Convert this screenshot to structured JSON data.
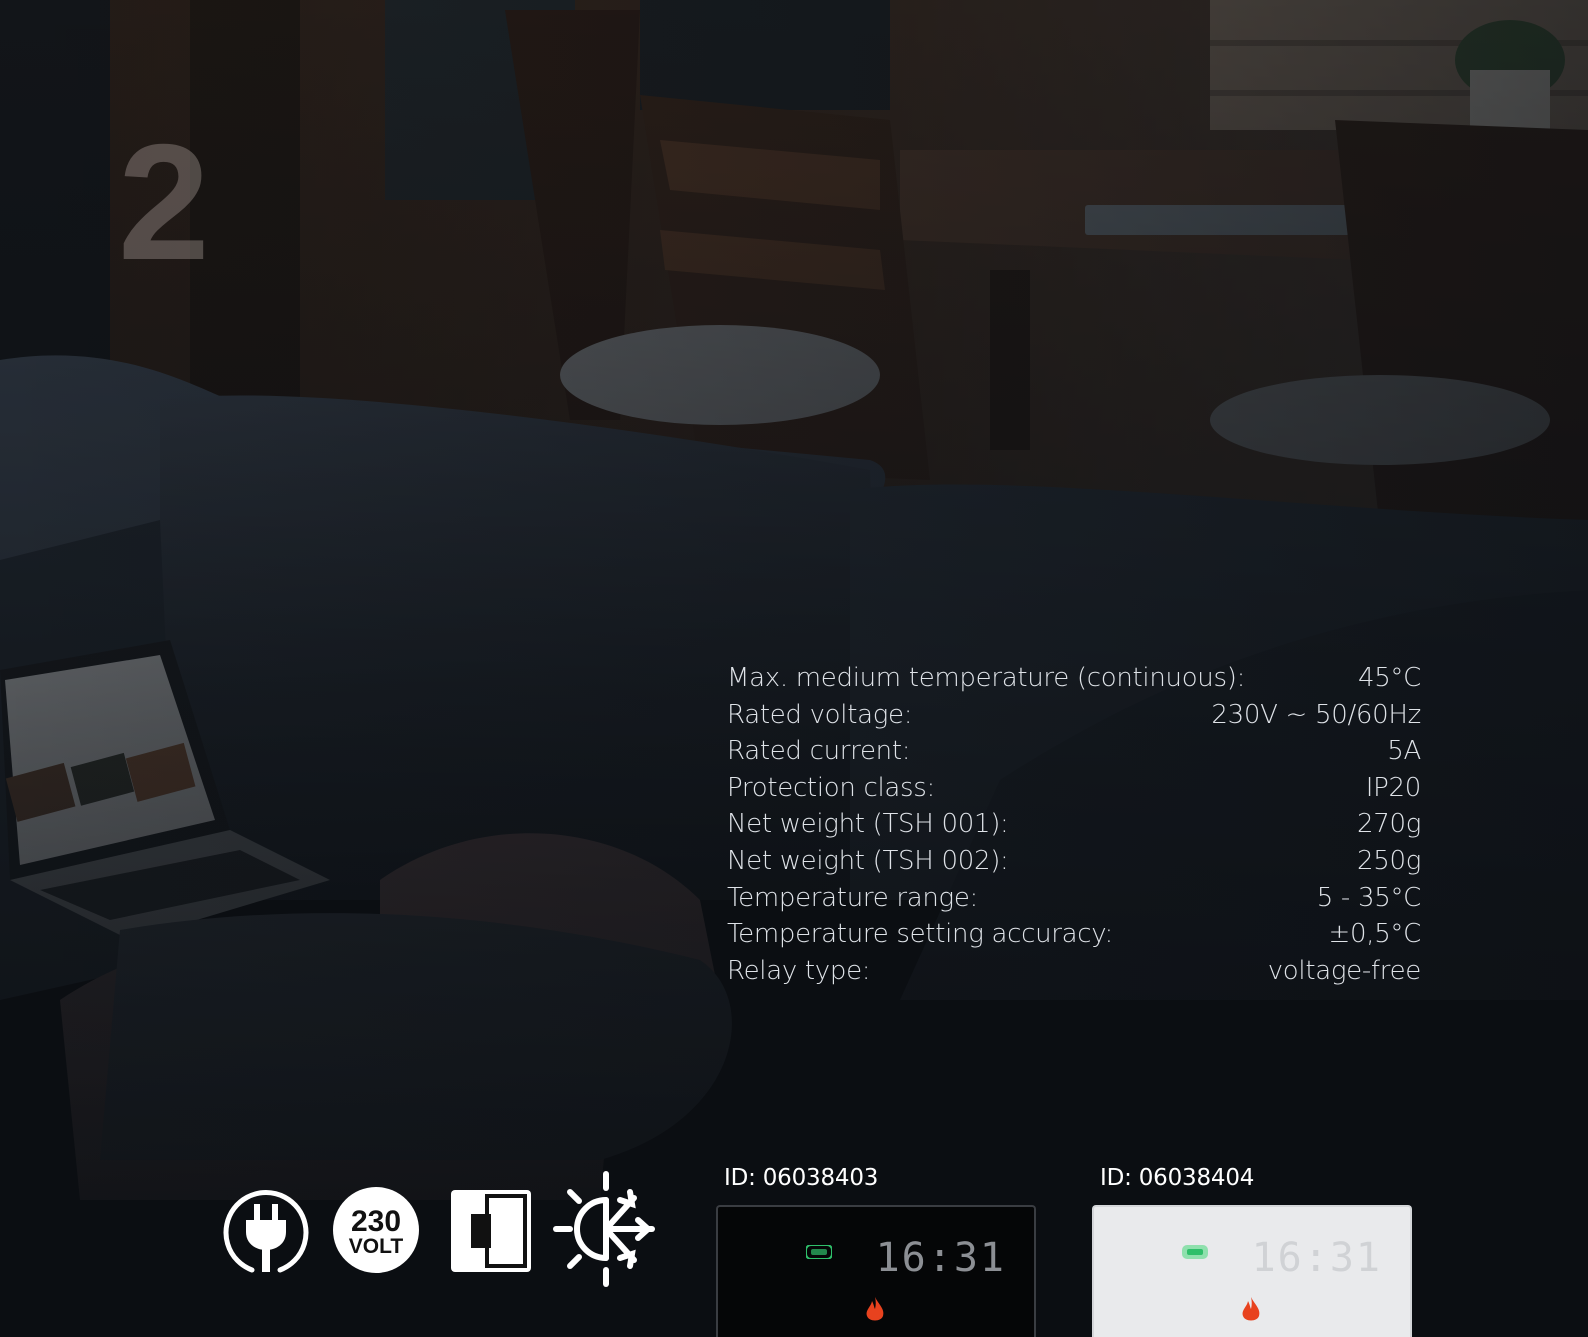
{
  "page": {
    "number": "2"
  },
  "specs": [
    {
      "label": "Max. medium temperature (continuous):",
      "value": "45°C"
    },
    {
      "label": "Rated voltage:",
      "value": "230V ~ 50/60Hz"
    },
    {
      "label": "Rated current:",
      "value": "5A"
    },
    {
      "label": "Protection class:",
      "value": "IP20"
    },
    {
      "label": "Net weight (TSH 001):",
      "value": "270g"
    },
    {
      "label": "Net weight (TSH 002):",
      "value": "250g"
    },
    {
      "label": "Temperature range:",
      "value": "5 - 35°C"
    },
    {
      "label": "Temperature setting accuracy:",
      "value": "±0,5°C"
    },
    {
      "label": "Relay type:",
      "value": "voltage-free"
    }
  ],
  "icons": [
    {
      "name": "plug-icon"
    },
    {
      "name": "voltage-230-icon",
      "line1": "230",
      "line2": "VOLT"
    },
    {
      "name": "wall-mount-icon"
    },
    {
      "name": "heating-cooling-icon"
    }
  ],
  "products": [
    {
      "id": "ID: 06038403",
      "variant": "black",
      "time": "16:31"
    },
    {
      "id": "ID: 06038404",
      "variant": "white",
      "time": "16:31"
    }
  ],
  "colors": {
    "text": "#dfe3e8",
    "flame": "#e8421e",
    "wifi": "#2fbf6a"
  }
}
